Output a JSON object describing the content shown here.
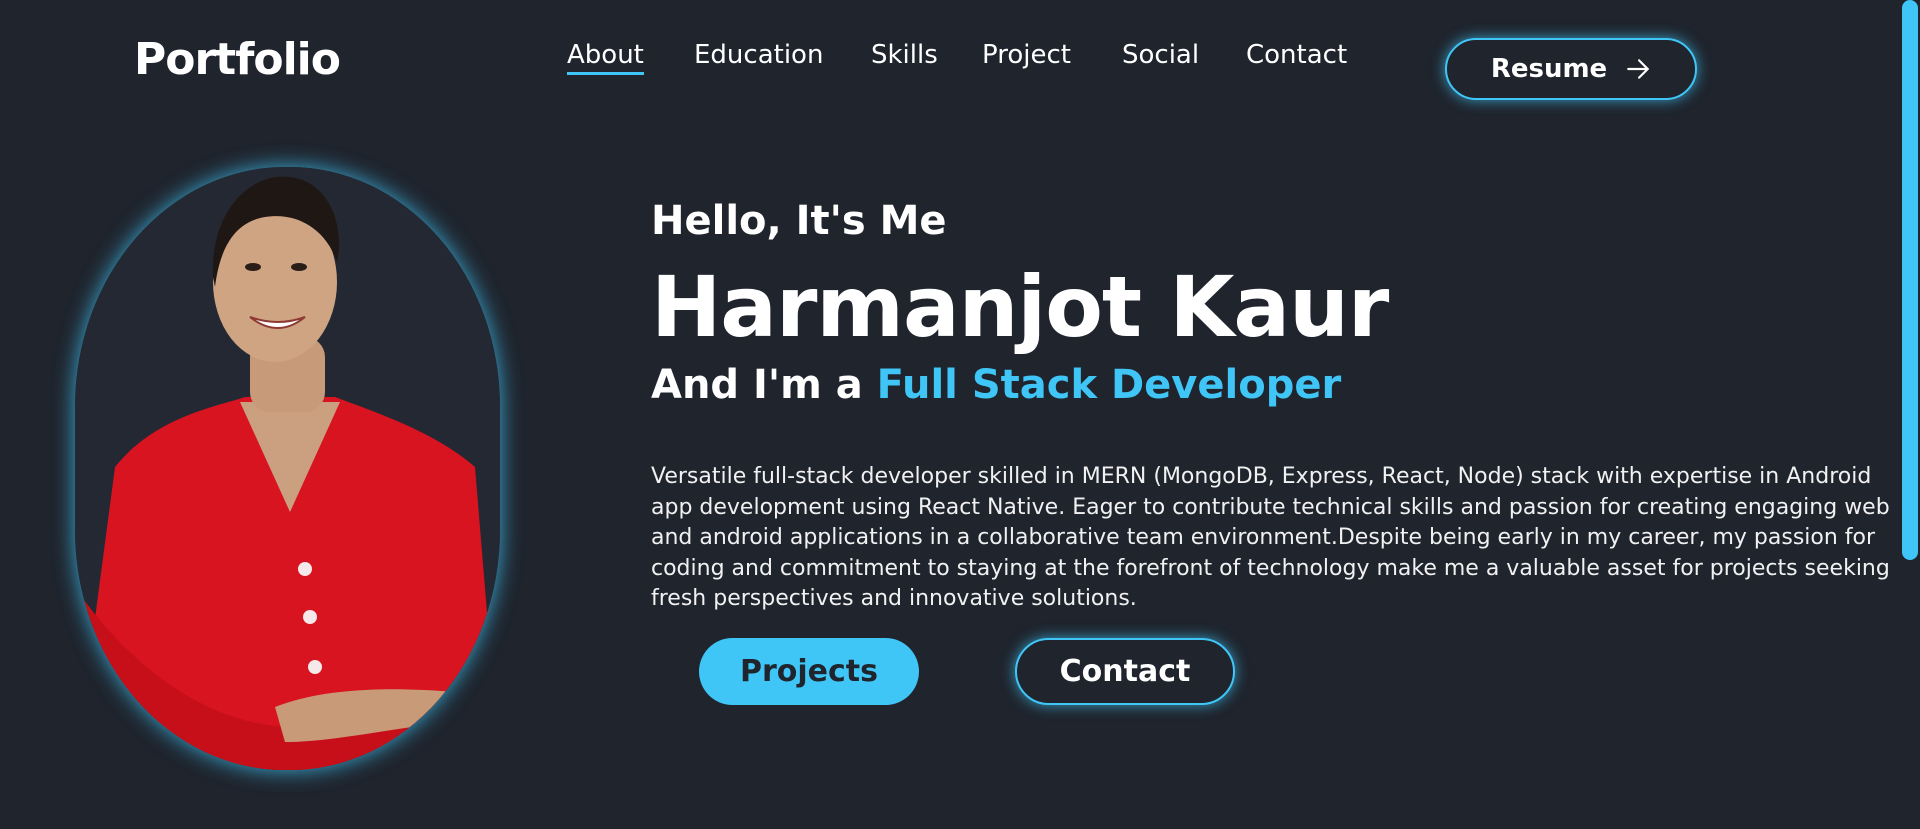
{
  "header": {
    "logo": "Portfolio",
    "nav": [
      {
        "label": "About",
        "active": true
      },
      {
        "label": "Education",
        "active": false
      },
      {
        "label": "Skills",
        "active": false
      },
      {
        "label": "Project",
        "active": false
      },
      {
        "label": "Social",
        "active": false
      },
      {
        "label": "Contact",
        "active": false
      }
    ],
    "resume_label": "Resume",
    "resume_icon": "arrow-right-icon"
  },
  "hero": {
    "greeting": "Hello, It's Me",
    "name": "Harmanjot Kaur",
    "role_prefix": "And I'm a",
    "role_highlight": "Full Stack Developer",
    "description": "Versatile full-stack developer skilled in MERN (MongoDB, Express, React, Node) stack with expertise in Android app development using React Native. Eager to contribute technical skills and passion for creating engaging web and android applications in a collaborative team environment.Despite being early in my career, my passion for coding and commitment to staying at the forefront of technology make me a valuable asset for projects seeking fresh perspectives and innovative solutions.",
    "projects_button": "Projects",
    "contact_button": "Contact"
  },
  "colors": {
    "background": "#1f242d",
    "accent": "#3fc6f7",
    "text": "#ffffff"
  }
}
